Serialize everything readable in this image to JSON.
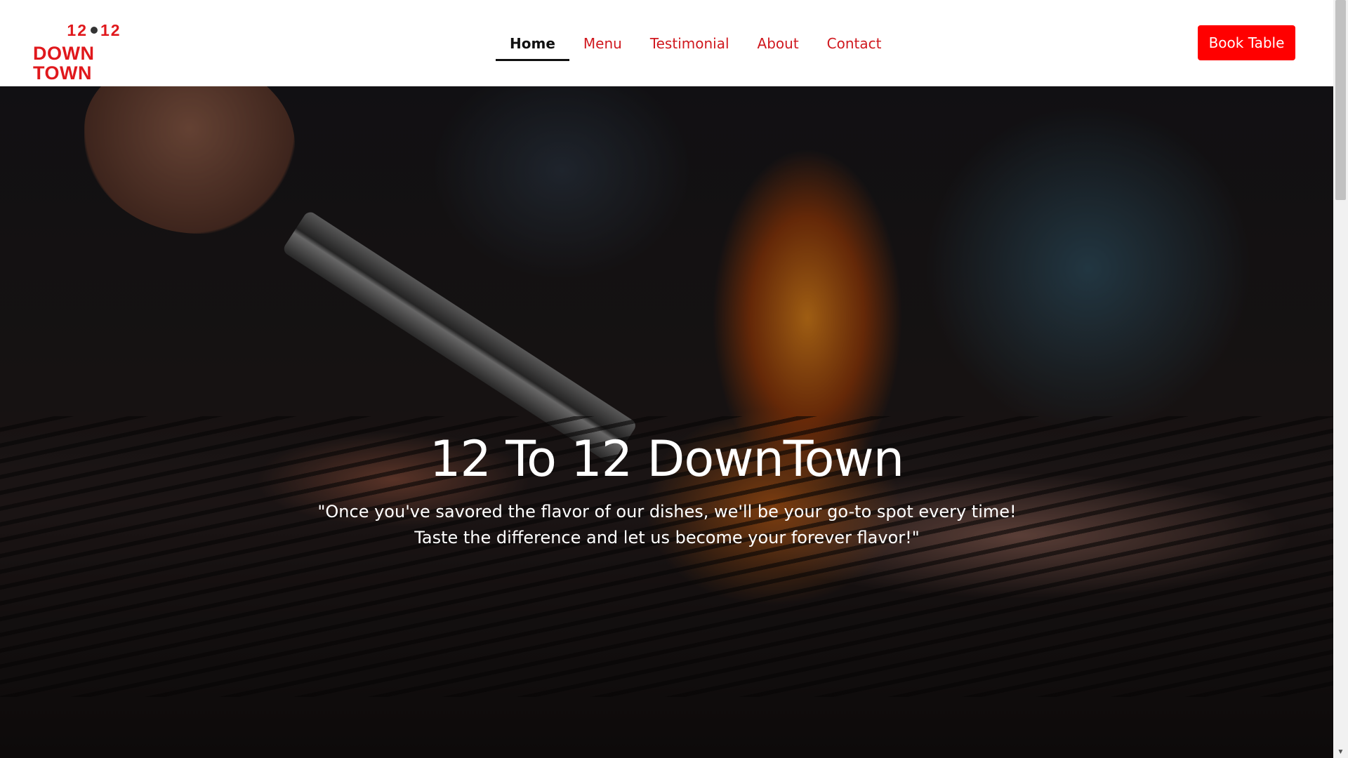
{
  "logo": {
    "line1_left": "12",
    "line1_right": "12",
    "line2": "DOWN TOWN"
  },
  "nav": {
    "items": [
      {
        "label": "Home",
        "active": true
      },
      {
        "label": "Menu",
        "active": false
      },
      {
        "label": "Testimonial",
        "active": false
      },
      {
        "label": "About",
        "active": false
      },
      {
        "label": "Contact",
        "active": false
      }
    ]
  },
  "header": {
    "book_label": "Book Table"
  },
  "hero": {
    "title": "12 To 12 DownTown",
    "subtitle": "\"Once you've savored the flavor of our dishes, we'll be your go-to spot every time! Taste the difference and let us become your forever flavor!\""
  },
  "colors": {
    "brand_red": "#ff0000",
    "nav_link": "#d0181e",
    "active_nav": "#111111",
    "header_bg": "#ffffff"
  },
  "icons": {
    "scroll_down": "triangle-down-icon"
  },
  "scroll_down_glyph": "▼"
}
